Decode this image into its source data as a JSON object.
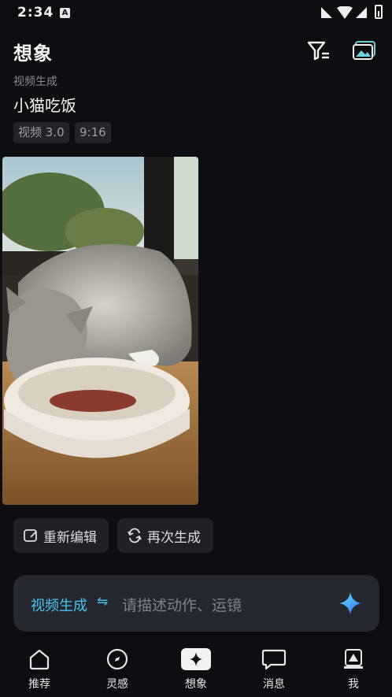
{
  "status_bar": {
    "time": "2:34",
    "notification_badge": "A"
  },
  "header": {
    "title": "想象",
    "filter_icon": "filter-icon",
    "gallery_icon": "gallery-icon"
  },
  "card": {
    "source": "视频生成",
    "prompt": "小猫吃饭",
    "tags": [
      "视频 3.0",
      "9:16"
    ]
  },
  "actions": {
    "edit_label": "重新编辑",
    "regenerate_label": "再次生成"
  },
  "input_bar": {
    "mode_label": "视频生成",
    "mode_switch": "⇋",
    "placeholder": "请描述动作、运镜"
  },
  "nav": {
    "items": [
      {
        "label": "推荐",
        "icon": "home-icon"
      },
      {
        "label": "灵感",
        "icon": "compass-icon"
      },
      {
        "label": "想象",
        "icon": "sparkle-icon"
      },
      {
        "label": "消息",
        "icon": "message-icon"
      },
      {
        "label": "我",
        "icon": "avatar-icon"
      }
    ]
  },
  "colors": {
    "background": "#0d0e12",
    "accent": "#46c3f0",
    "surface": "#262830"
  }
}
